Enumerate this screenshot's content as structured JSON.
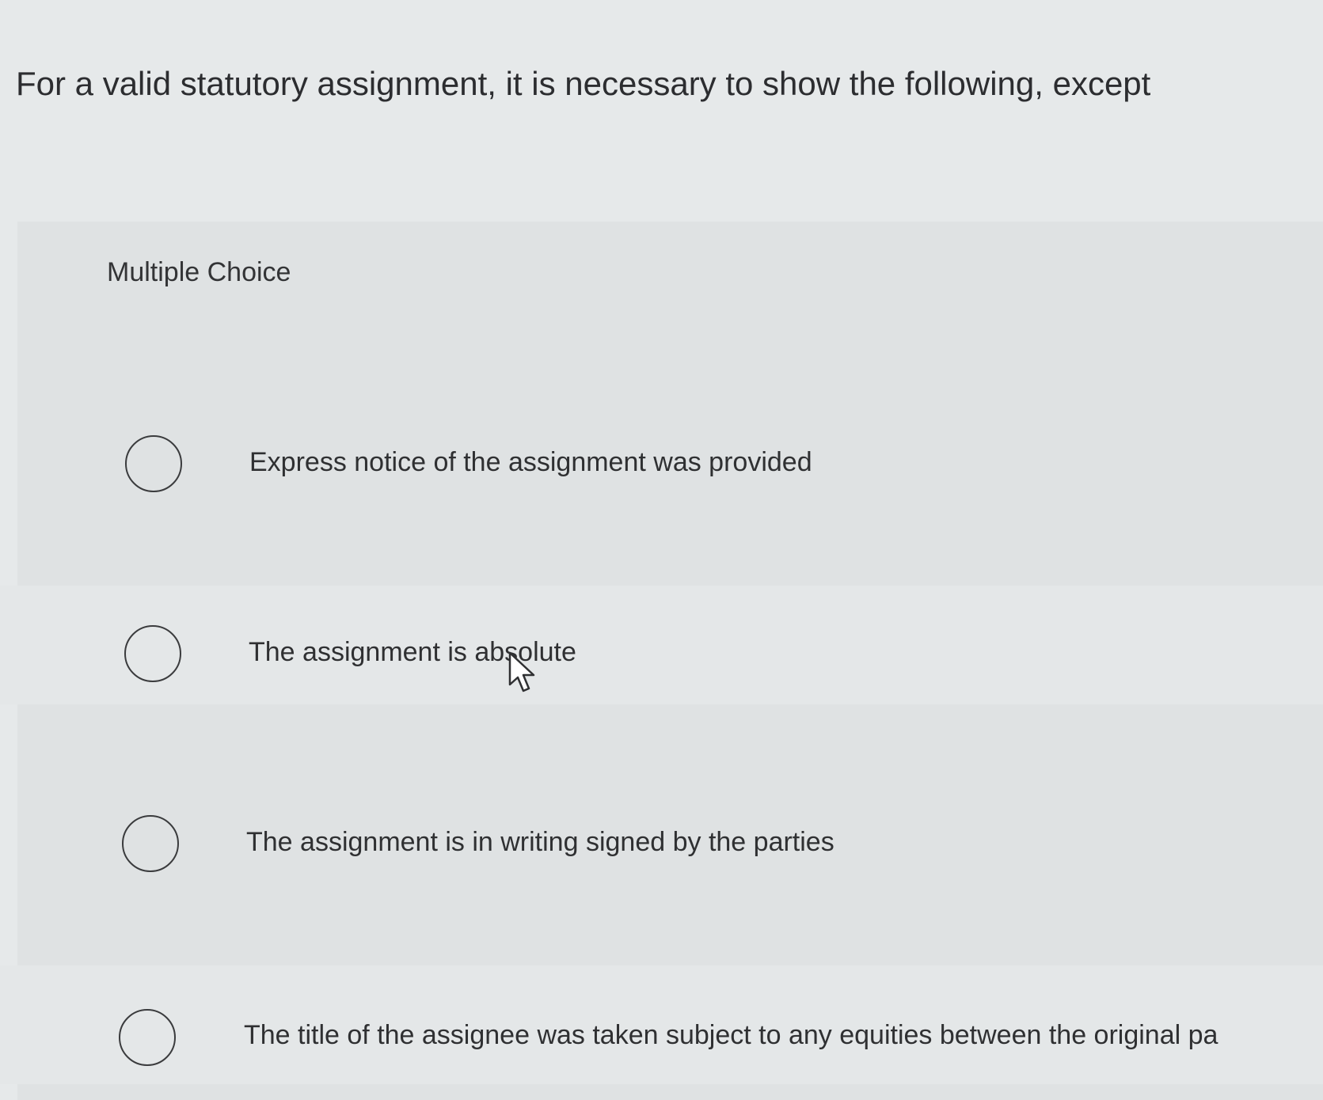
{
  "question": {
    "text": "For a valid statutory assignment, it is necessary to show the following, except"
  },
  "multiple_choice": {
    "label": "Multiple Choice",
    "options": [
      {
        "label": "Express notice of the assignment was provided",
        "selected": false
      },
      {
        "label": "The assignment is absolute",
        "selected": false
      },
      {
        "label": "The assignment is in writing signed by the parties",
        "selected": false
      },
      {
        "label": "The title of the assignee was taken subject to any equities between the original pa",
        "selected": false
      }
    ]
  },
  "icons": {
    "radio": "radio-button-icon",
    "cursor": "mouse-pointer-icon"
  }
}
